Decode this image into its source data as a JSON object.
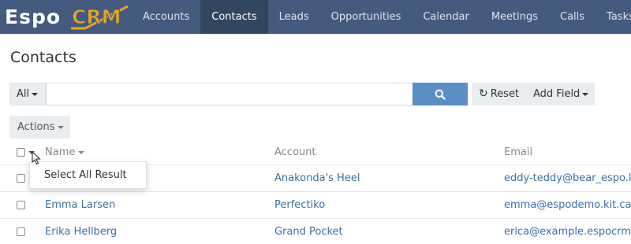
{
  "brand": {
    "part1": "Espo",
    "part2": "CRM"
  },
  "nav": {
    "tabs": [
      {
        "label": "Accounts",
        "active": false
      },
      {
        "label": "Contacts",
        "active": true
      },
      {
        "label": "Leads",
        "active": false
      },
      {
        "label": "Opportunities",
        "active": false
      },
      {
        "label": "Calendar",
        "active": false
      },
      {
        "label": "Meetings",
        "active": false
      },
      {
        "label": "Calls",
        "active": false
      },
      {
        "label": "Tasks",
        "active": false
      }
    ]
  },
  "page": {
    "title": "Contacts"
  },
  "search": {
    "filter_label": "All",
    "value": "",
    "placeholder": "",
    "reset_label": "Reset",
    "add_field_label": "Add Field"
  },
  "actions": {
    "label": "Actions"
  },
  "table": {
    "columns": {
      "name": "Name",
      "account": "Account",
      "email": "Email"
    },
    "rows": [
      {
        "name": "",
        "account": "Anakonda's Heel",
        "email": "eddy-teddy@bear_espo.lu"
      },
      {
        "name": "Emma Larsen",
        "account": "Perfectiko",
        "email": "emma@espodemo.kit.ca"
      },
      {
        "name": "Erika Hellberg",
        "account": "Grand Pocket",
        "email": "erica@example.espocrm.com"
      }
    ]
  },
  "dropdown": {
    "select_all_label": "Select All Result"
  },
  "colors": {
    "navbar": "#445a7e",
    "nav_active": "#34455f",
    "brand_accent": "#e8a51c",
    "link": "#3b6ea5",
    "search_button": "#5b8ec4",
    "button_bg": "#eaedf0"
  },
  "icons": {
    "search": "search-icon",
    "reset": "refresh-icon",
    "caret": "caret-down-icon",
    "cursor": "mouse-cursor-icon"
  }
}
